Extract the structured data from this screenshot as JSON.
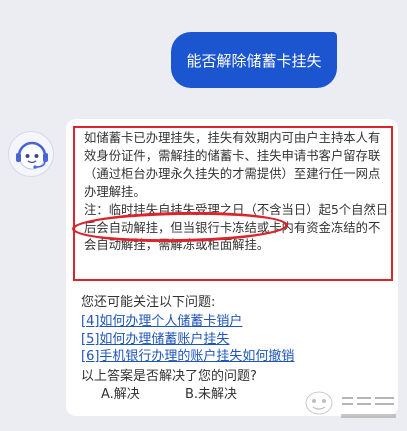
{
  "user_message": "能否解除储蓄卡挂失",
  "bot_reply": {
    "paragraph_1": "如储蓄卡已办理挂失，挂失有效期内可由户主持本人有效身份证件，需解挂的储蓄卡、挂失申请书客户留存联（通过柜台办理永久挂失的才需提供）至建行任一网点办理解挂。",
    "paragraph_2": "注：临时挂失自挂失受理之日（不含当日）起5个自然日后会自动解挂，但当银行卡冻结或卡内有资金冻结的不会自动解挂，需解冻或柜面解挂。"
  },
  "related": {
    "title": "您还可能关注以下问题:",
    "items": [
      "[4]如何办理个人储蓄卡销户",
      "[5]如何办理储蓄账户挂失",
      "[6]手机银行办理的账户挂失如何撤销"
    ]
  },
  "survey": {
    "question": "以上答案是否解决了您的问题?",
    "option_a": "A.解决",
    "option_b": "B.未解决"
  },
  "colors": {
    "background": "#ebedf2",
    "user_bubble": "#1b55cf",
    "annotation_red": "#d9252b",
    "link": "#1f55b8"
  },
  "icons": {
    "avatar": "robot-headset-icon",
    "watermark": "baidu-jingyan-watermark"
  }
}
